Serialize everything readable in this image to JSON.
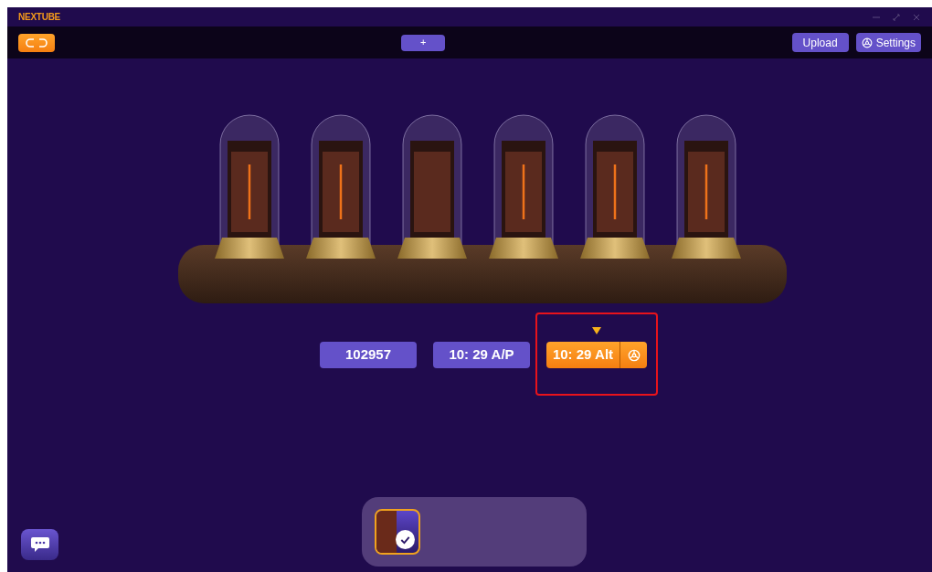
{
  "window": {
    "title": "NEXTUBE"
  },
  "toolbar": {
    "add_button": "+",
    "upload_button": "Upload",
    "settings_button": "Settings"
  },
  "modes": [
    {
      "label": "102957",
      "selected": false,
      "has_settings": false
    },
    {
      "label": "10: 29 A/P",
      "selected": false,
      "has_settings": false
    },
    {
      "label": "10: 29 Alt",
      "selected": true,
      "has_settings": true
    }
  ],
  "highlight_selected": true,
  "themes": [
    {
      "selected": true
    }
  ]
}
